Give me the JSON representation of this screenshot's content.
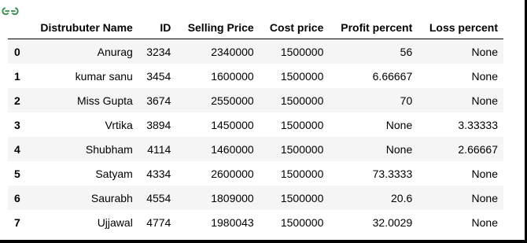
{
  "logo": {
    "icon": "gfg-logo-icon"
  },
  "table": {
    "headers": [
      "",
      "Distrubuter Name",
      "ID",
      "Selling Price",
      "Cost price",
      "Profit percent",
      "Loss percent"
    ],
    "rows": [
      {
        "index": "0",
        "cells": [
          "Anurag",
          "3234",
          "2340000",
          "1500000",
          "56",
          "None"
        ]
      },
      {
        "index": "1",
        "cells": [
          "kumar sanu",
          "3454",
          "1600000",
          "1500000",
          "6.66667",
          "None"
        ]
      },
      {
        "index": "2",
        "cells": [
          "Miss Gupta",
          "3674",
          "2550000",
          "1500000",
          "70",
          "None"
        ]
      },
      {
        "index": "3",
        "cells": [
          "Vrtika",
          "3894",
          "1450000",
          "1500000",
          "None",
          "3.33333"
        ]
      },
      {
        "index": "4",
        "cells": [
          "Shubham",
          "4114",
          "1460000",
          "1500000",
          "None",
          "2.66667"
        ]
      },
      {
        "index": "5",
        "cells": [
          "Satyam",
          "4334",
          "2600000",
          "1500000",
          "73.3333",
          "None"
        ]
      },
      {
        "index": "6",
        "cells": [
          "Saurabh",
          "4554",
          "1809000",
          "1500000",
          "20.6",
          "None"
        ]
      },
      {
        "index": "7",
        "cells": [
          "Ujjawal",
          "4774",
          "1980043",
          "1500000",
          "32.0029",
          "None"
        ]
      }
    ]
  },
  "colors": {
    "logo_green": "#2f8d46",
    "row_stripe": "#f5f5f5",
    "border": "#000000"
  }
}
